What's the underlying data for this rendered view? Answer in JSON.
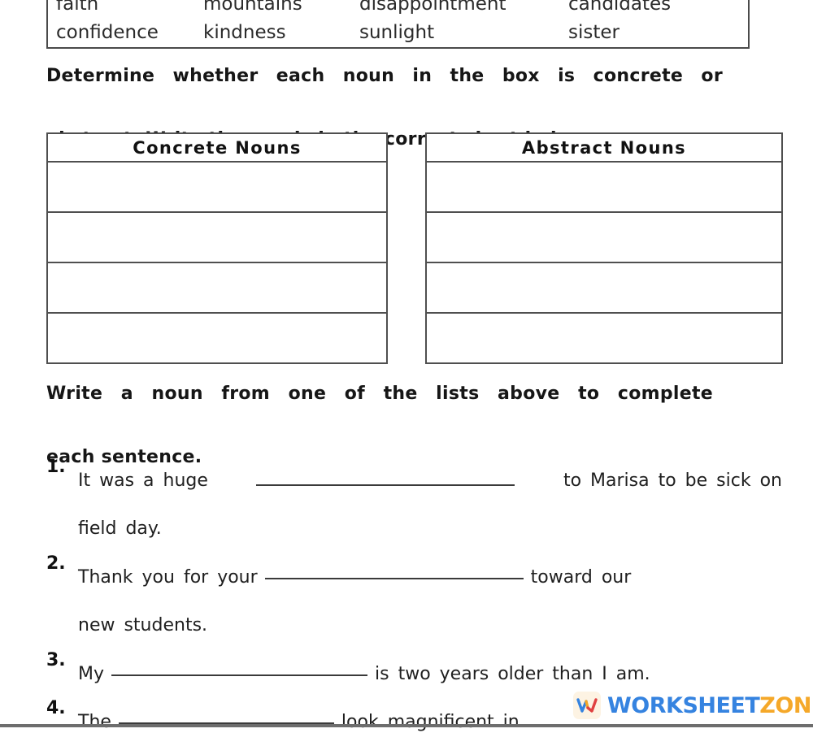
{
  "word_bank": {
    "words": [
      "faith",
      "mountains",
      "disappointment",
      "candidates",
      "confidence",
      "kindness",
      "sunlight",
      "sister"
    ]
  },
  "instructions": {
    "first": {
      "line1": "Determine whether each noun in the box is concrete or",
      "line2": "abstract. Write the words in the correct chart below."
    },
    "second": {
      "line1": "Write a noun from one of the lists above to complete",
      "line2": "each sentence."
    }
  },
  "charts": [
    {
      "title": "Concrete Nouns",
      "rows": [
        "",
        "",
        "",
        ""
      ]
    },
    {
      "title": "Abstract Nouns",
      "rows": [
        "",
        "",
        "",
        ""
      ]
    }
  ],
  "questions": [
    {
      "number": "1.",
      "before": "It was a huge",
      "after": "to Marisa to be sick on",
      "line2": "field day."
    },
    {
      "number": "2.",
      "before": "Thank you for your",
      "after": "toward our",
      "line2": "new students."
    },
    {
      "number": "3.",
      "before": "My",
      "after": "is two years older than I am.",
      "line2": ""
    },
    {
      "number": "4.",
      "before": "The",
      "after": "look magnificent in",
      "line2": ""
    }
  ],
  "watermark": {
    "text_primary": "WORKSHEET",
    "text_secondary": "ZONE",
    "logo_letter": "W",
    "color_primary": "#2f7fe0",
    "color_secondary": "#f5a623",
    "logo_colors": [
      "#2f7fe0",
      "#f5a623",
      "#e03b3b"
    ]
  }
}
